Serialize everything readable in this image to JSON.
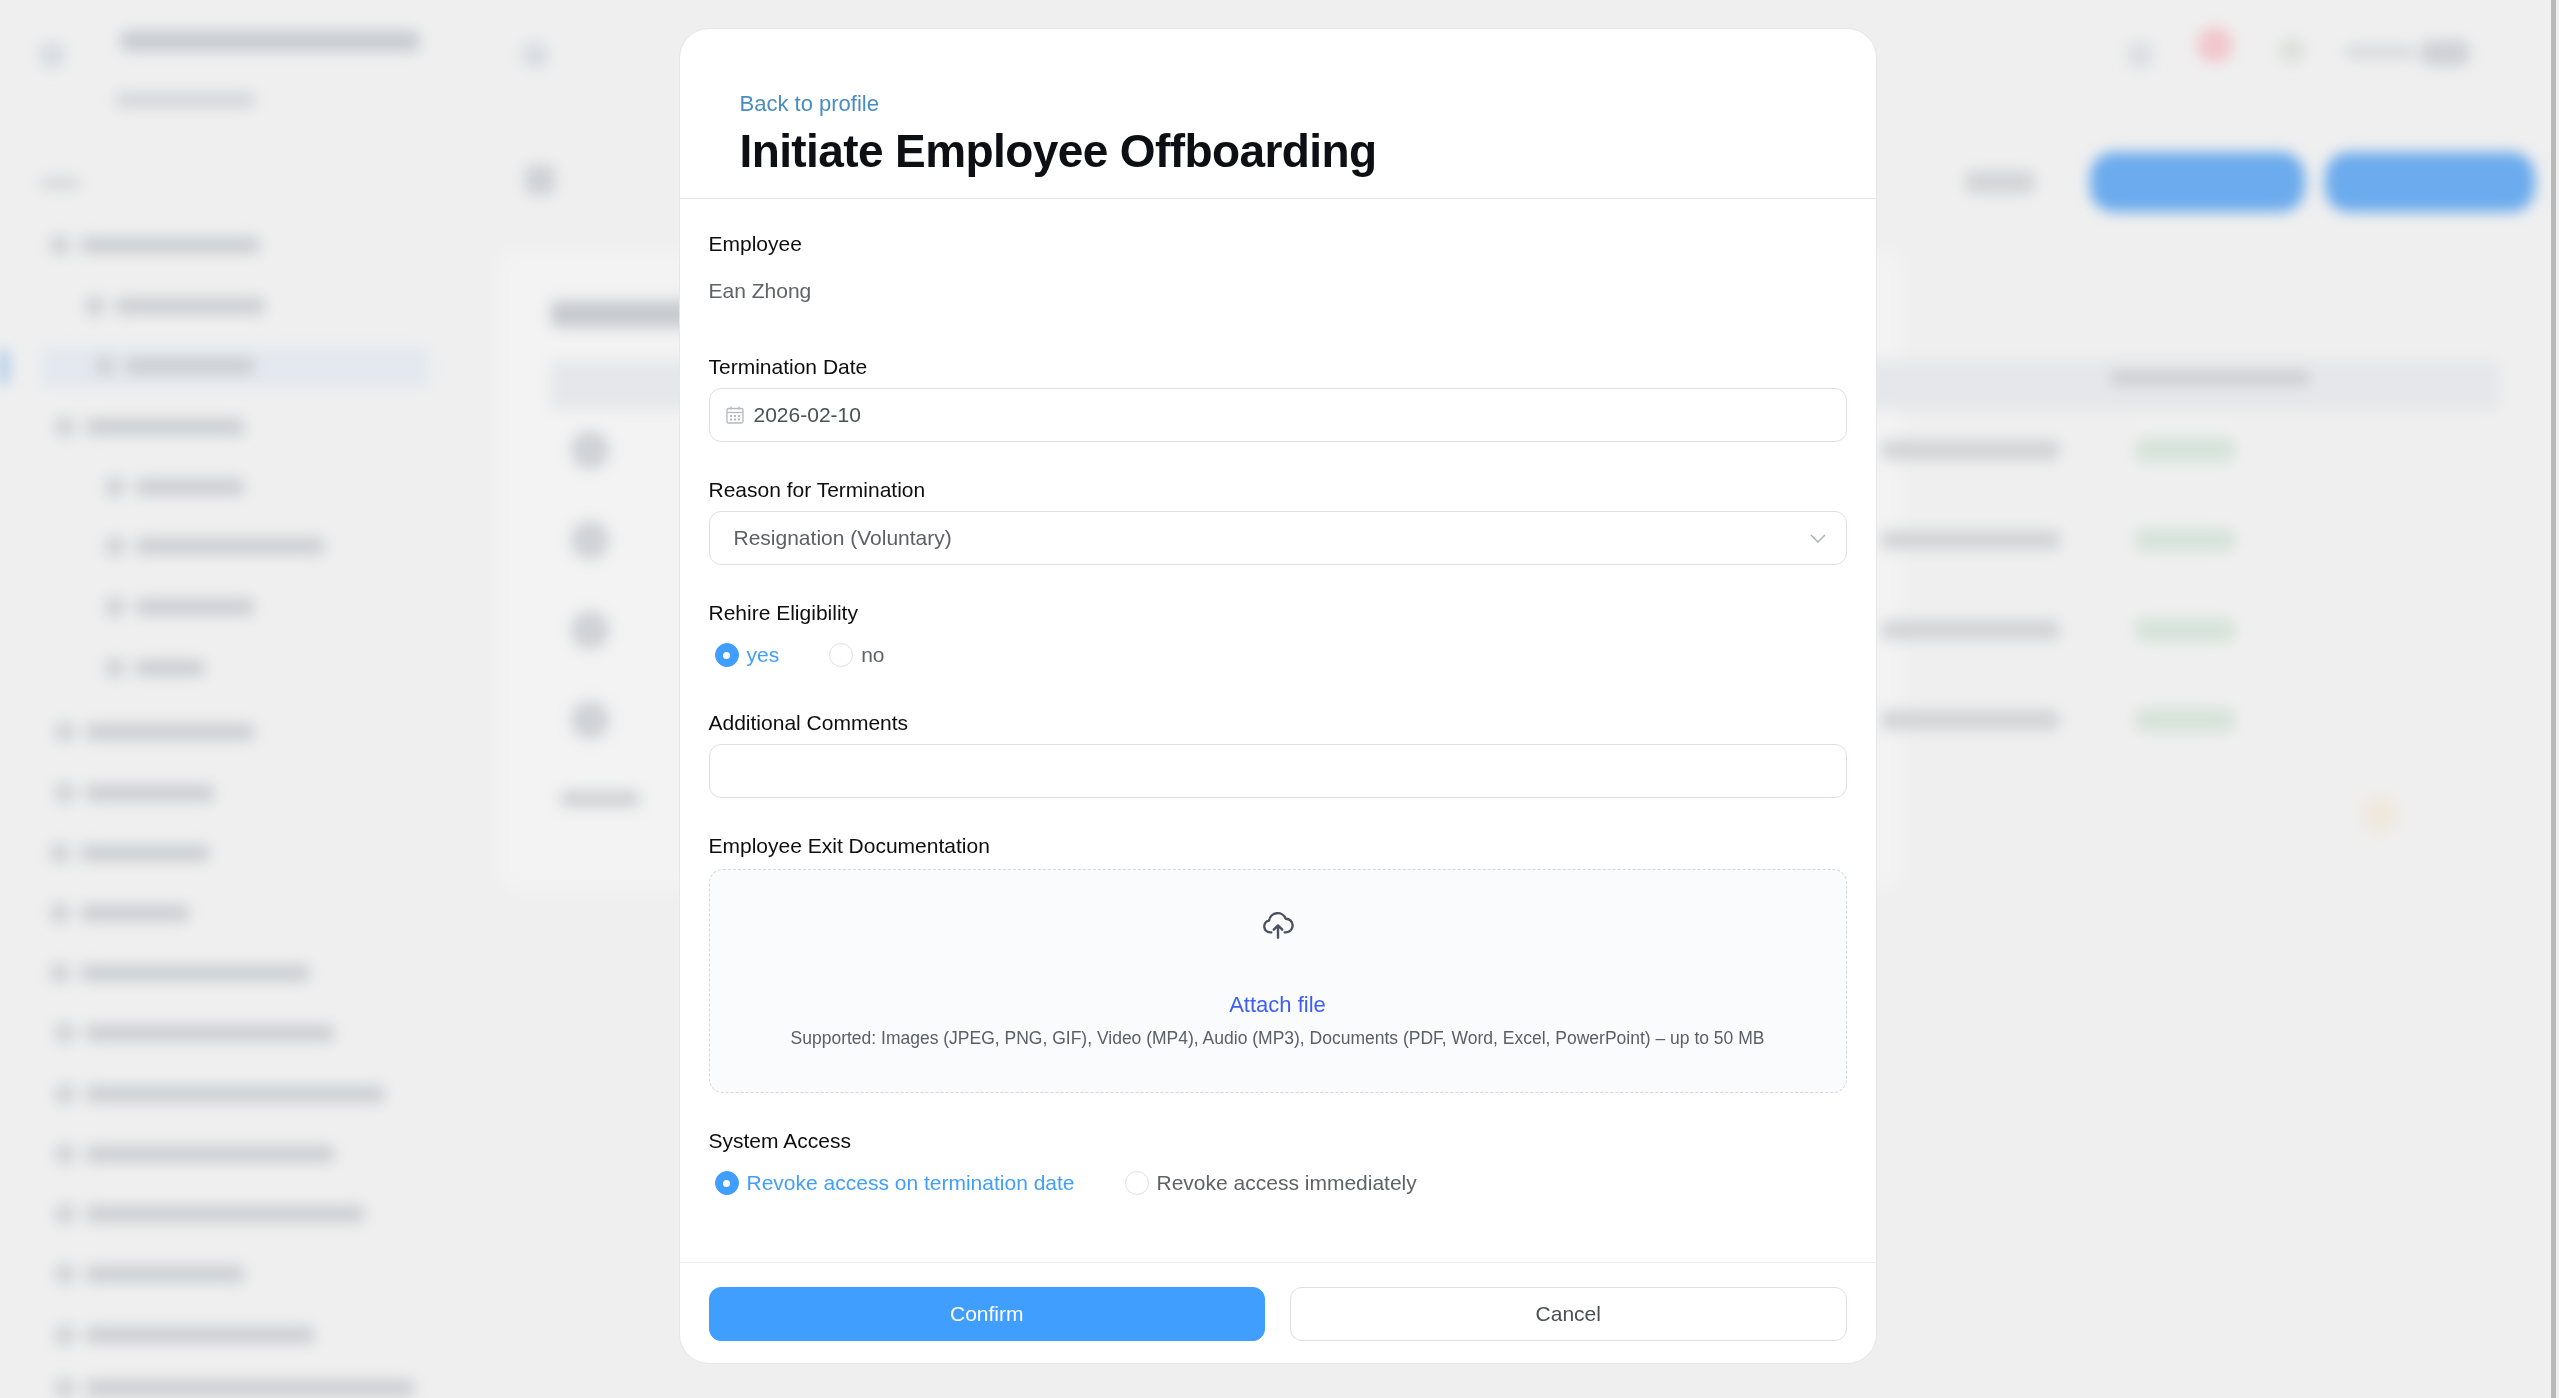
{
  "dialog": {
    "back_link": "Back to profile",
    "title": "Initiate Employee Offboarding"
  },
  "fields": [
    {
      "kind": "static",
      "label": "Employee",
      "value": "Ean Zhong"
    },
    {
      "kind": "date",
      "label": "Termination Date",
      "value": "2026-02-10"
    },
    {
      "kind": "select",
      "label": "Reason for Termination",
      "value": "Resignation (Voluntary)"
    },
    {
      "kind": "radio",
      "label": "Rehire Eligibility",
      "options": [
        {
          "label": "yes",
          "selected": true
        },
        {
          "label": "no",
          "selected": false
        }
      ]
    },
    {
      "kind": "text",
      "label": "Additional Comments"
    },
    {
      "kind": "upload",
      "label": "Employee Exit Documentation",
      "action": "Attach file",
      "hint": "Supported: Images (JPEG, PNG, GIF), Video (MP4), Audio (MP3), Documents (PDF, Word, Excel, PowerPoint) – up to 50 MB"
    },
    {
      "kind": "radio",
      "label": "System Access",
      "options": [
        {
          "label": "Revoke access on termination date",
          "selected": true
        },
        {
          "label": "Revoke access immediately",
          "selected": false
        }
      ]
    }
  ],
  "buttons": [
    {
      "kind": "primary",
      "label": "Confirm"
    },
    {
      "kind": "secondary",
      "label": "Cancel"
    }
  ]
}
